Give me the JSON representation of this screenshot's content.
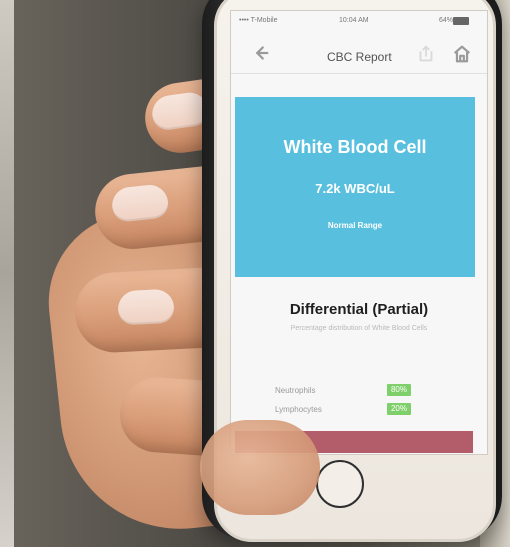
{
  "status_bar": {
    "carrier": "•••• T-Mobile",
    "time": "10:04 AM",
    "battery": "64%"
  },
  "nav": {
    "title": "CBC Report",
    "back_icon": "back-arrow-icon",
    "share_icon": "share-icon",
    "home_icon": "home-icon"
  },
  "wbc": {
    "title": "White Blood Cell",
    "value": "7.2k WBC/uL",
    "range": "Normal Range",
    "card_color": "#58c0de"
  },
  "differential": {
    "title": "Differential (Partial)",
    "subtitle": "Percentage distribution of White Blood Cells",
    "rows": [
      {
        "label": "Neutrophils",
        "value": "80%"
      },
      {
        "label": "Lymphocytes",
        "value": "20%"
      }
    ],
    "badge_color": "#7fcf6a"
  },
  "colors": {
    "footer_band": "#b45d6a"
  }
}
